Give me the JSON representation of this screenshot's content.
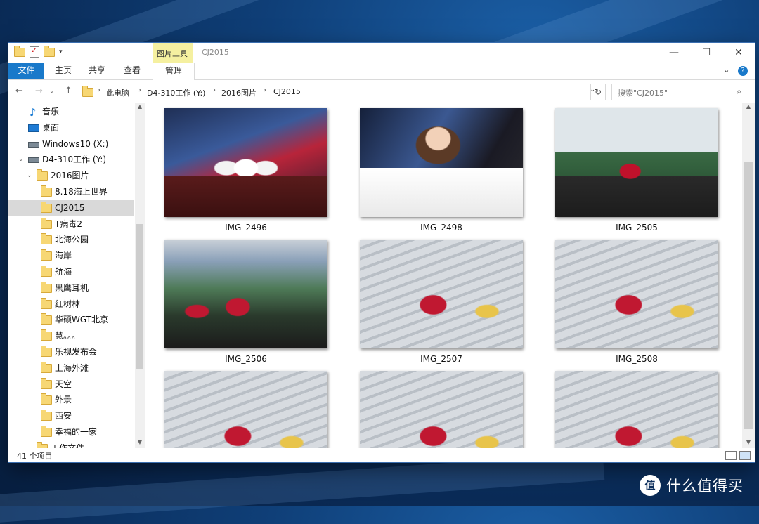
{
  "window": {
    "title": "CJ2015",
    "tool_tab_label": "图片工具",
    "minimize": "—",
    "maximize": "☐",
    "close": "✕"
  },
  "ribbon": {
    "tabs": [
      "文件",
      "主页",
      "共享",
      "查看",
      "管理"
    ],
    "collapse": "⌄",
    "help": "?"
  },
  "address_bar": {
    "back": "←",
    "forward": "→",
    "recent": "⌄",
    "up": "↑",
    "crumbs": [
      "此电脑",
      "D4-310工作 (Y:)",
      "2016图片",
      "CJ2015"
    ],
    "separator": "›",
    "dropdown": "⌄",
    "refresh": "↻",
    "search_placeholder": "搜索\"CJ2015\"",
    "search_icon": "⌕"
  },
  "sidebar": {
    "items": [
      {
        "label": "音乐",
        "icon": "music-icon",
        "indent": 1
      },
      {
        "label": "桌面",
        "icon": "desktop-icon",
        "indent": 1
      },
      {
        "label": "Windows10 (X:)",
        "icon": "drive-icon",
        "indent": 1
      },
      {
        "label": "D4-310工作 (Y:)",
        "icon": "drive-icon",
        "indent": 1,
        "expanded": true
      },
      {
        "label": "2016图片",
        "icon": "folder-icon",
        "indent": 2,
        "expanded": true
      },
      {
        "label": "8.18海上世界",
        "icon": "folder-icon",
        "indent": 3
      },
      {
        "label": "CJ2015",
        "icon": "folder-icon",
        "indent": 3,
        "selected": true
      },
      {
        "label": "T病毒2",
        "icon": "folder-icon",
        "indent": 3
      },
      {
        "label": "北海公园",
        "icon": "folder-icon",
        "indent": 3
      },
      {
        "label": "海岸",
        "icon": "folder-icon",
        "indent": 3
      },
      {
        "label": "航海",
        "icon": "folder-icon",
        "indent": 3
      },
      {
        "label": "黑鹰耳机",
        "icon": "folder-icon",
        "indent": 3
      },
      {
        "label": "红树林",
        "icon": "folder-icon",
        "indent": 3
      },
      {
        "label": "华硕WGT北京",
        "icon": "folder-icon",
        "indent": 3
      },
      {
        "label": "慧。。。",
        "icon": "folder-icon",
        "indent": 3
      },
      {
        "label": "乐视发布会",
        "icon": "folder-icon",
        "indent": 3
      },
      {
        "label": "上海外滩",
        "icon": "folder-icon",
        "indent": 3
      },
      {
        "label": "天空",
        "icon": "folder-icon",
        "indent": 3
      },
      {
        "label": "外景",
        "icon": "folder-icon",
        "indent": 3
      },
      {
        "label": "西安",
        "icon": "folder-icon",
        "indent": 3
      },
      {
        "label": "幸福的一家",
        "icon": "folder-icon",
        "indent": 3
      },
      {
        "label": "工作文件",
        "icon": "folder-icon",
        "indent": 2
      }
    ],
    "scroll_up": "▲",
    "scroll_down": "▼"
  },
  "files": [
    {
      "name": "IMG_2496",
      "scene": "stage-seated"
    },
    {
      "name": "IMG_2498",
      "scene": "portrait"
    },
    {
      "name": "IMG_2505",
      "scene": "arena"
    },
    {
      "name": "IMG_2506",
      "scene": "dancers-screen"
    },
    {
      "name": "IMG_2507",
      "scene": "truss-dance"
    },
    {
      "name": "IMG_2508",
      "scene": "truss-dance"
    },
    {
      "name": "",
      "scene": "truss-dance"
    },
    {
      "name": "",
      "scene": "truss-dance"
    },
    {
      "name": "",
      "scene": "truss-dance"
    }
  ],
  "status": {
    "item_count": "41 个项目"
  },
  "watermark": {
    "logo": "值",
    "text": "什么值得买"
  },
  "colors": {
    "accent": "#1979ca",
    "tool_tab": "#f5f0a0",
    "selected_row": "#d9d9d9",
    "folder": "#f7d774"
  }
}
